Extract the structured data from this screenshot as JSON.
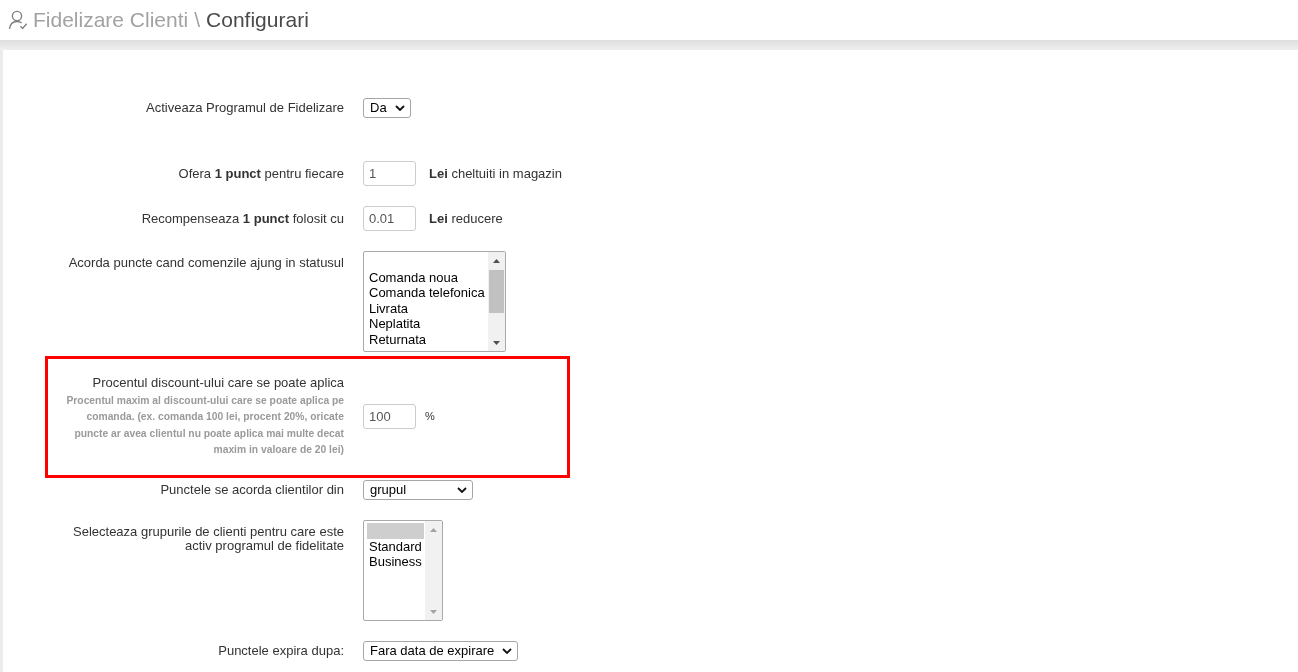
{
  "header": {
    "section": "Fidelizare Clienti",
    "separator": "\\",
    "page": "Configurari"
  },
  "settings": [
    {
      "kind": "select",
      "label": "Activeaza Programul de Fidelizare",
      "value": "Da",
      "highlighted": false
    },
    {
      "kind": "input",
      "label": "Ofera **1 punct** pentru fiecare",
      "value": "1",
      "suffix": "**Lei** cheltuiti in magazin",
      "highlighted": false
    },
    {
      "kind": "input",
      "label": "Recompenseaza **1 punct** folosit cu",
      "value": "0.01",
      "suffix": "**Lei** reducere",
      "highlighted": false
    },
    {
      "kind": "listbox",
      "label": "Acorda puncte cand comenzile ajung in statusul",
      "options": [
        {
          "selected": false
        },
        {
          "label": "Comanda noua",
          "selected": false
        },
        {
          "label": "Comanda telefonica",
          "selected": false
        },
        {
          "label": "Livrata",
          "selected": false
        },
        {
          "label": "Neplatita",
          "selected": false
        },
        {
          "label": "Returnata",
          "selected": false
        }
      ],
      "highlighted": false
    },
    {
      "kind": "input",
      "label": "Procentul discount-ului care se poate aplica",
      "help": "Procentul maxim al discount-ului care se poate aplica pe comanda. (ex. comanda 100 lei, procent 20%, oricate puncte ar avea clientul nu poate aplica mai multe decat maxim in valoare de 20 lei)",
      "value": "100",
      "suffix": "%",
      "highlighted": true
    },
    {
      "kind": "select",
      "label": "Punctele se acorda clientilor din",
      "value": "grupul",
      "highlighted": false
    },
    {
      "kind": "listbox",
      "label": "Selecteaza grupurile de clienti pentru care este activ programul de fidelitate",
      "options": [
        {
          "selected": true
        },
        {
          "label": "Standard",
          "selected": false
        },
        {
          "label": "Business",
          "selected": false
        }
      ],
      "highlighted": false
    },
    {
      "kind": "select",
      "label": "Punctele expira dupa:",
      "value": "Fara data de expirare",
      "highlighted": false
    }
  ]
}
